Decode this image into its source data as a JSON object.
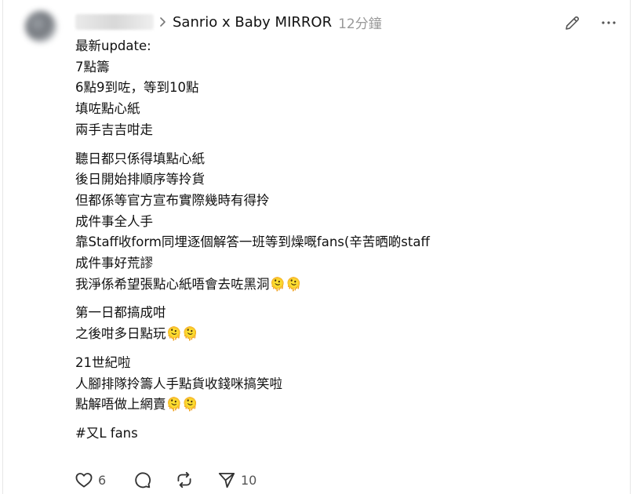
{
  "post": {
    "community": "Sanrio x Baby MIRROR",
    "time": "12分鐘",
    "username": " ",
    "paragraphs": [
      [
        "最新update:",
        "7點籌",
        "6點9到咗，等到10點",
        "填咗點心紙",
        "兩手吉吉咁走"
      ],
      [
        "聽日都只係得填點心紙",
        "後日開始排順序等拎貨",
        "但都係等官方宣布實際幾時有得拎",
        "成件事全人手",
        "靠Staff收form同埋逐個解答一班等到燥嘅fans(辛苦晒啲staff",
        "成件事好荒謬",
        "我淨係希望張點心紙唔會去咗黑洞🫠🫠"
      ],
      [
        "第一日都搞成咁",
        "之後咁多日點玩🫠🫠"
      ],
      [
        "21世紀啦",
        "人腳排隊拎籌人手點貨收錢咪搞笑啦",
        "點解唔做上網賣🫠🫠"
      ],
      [
        "#又L fans"
      ]
    ]
  },
  "actions": {
    "like_count": "6",
    "share_count": "10"
  },
  "icons": {
    "separator": "chevron-right-icon",
    "edit": "pencil-icon",
    "more": "more-horizontal-icon",
    "like": "heart-icon",
    "reply": "comment-icon",
    "repost": "repost-icon",
    "share": "send-icon"
  },
  "colors": {
    "text": "#111111",
    "muted": "#999999",
    "icon": "#333333"
  }
}
